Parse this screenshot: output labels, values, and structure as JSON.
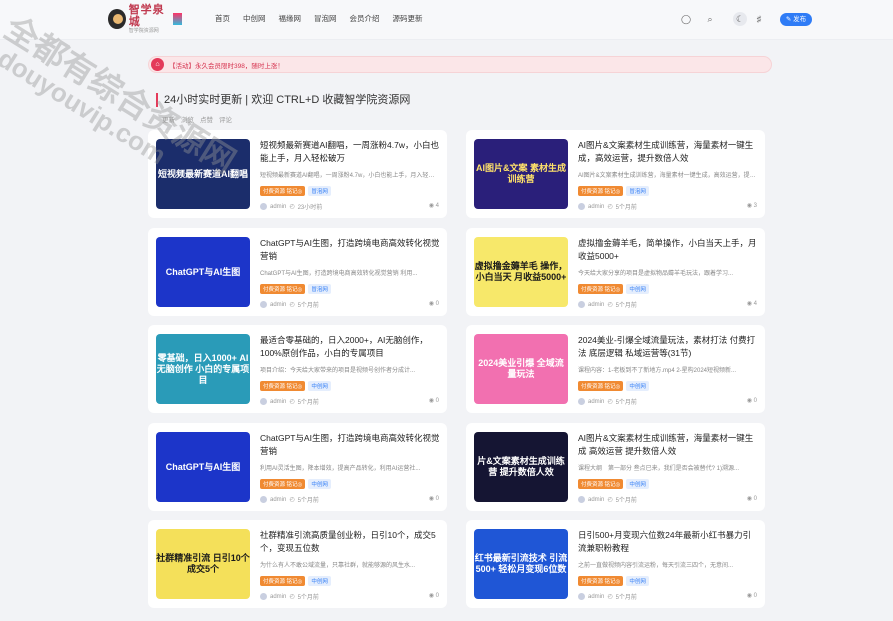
{
  "header": {
    "logo_text": "智学泉城",
    "logo_sub": "智学院资源网",
    "nav": [
      "首页",
      "中创网",
      "福缘网",
      "冒泡网",
      "会员介绍",
      "源码更新"
    ],
    "publish_label": "发布"
  },
  "notice": {
    "text": "【活动】永久会员限时398，随时上涨！"
  },
  "section": {
    "title": "24小时实时更新 | 欢迎 CTRL+D 收藏智学院资源网",
    "sort": [
      "更新",
      "浏览",
      "点赞",
      "评论"
    ]
  },
  "watermark": {
    "line1": "全都有综合资源网",
    "line2": "douyouvip.com"
  },
  "cards": [
    {
      "title": "短视频最新赛道AI翻唱，一周涨粉4.7w，小白也能上手，月入轻松破万",
      "desc": "短视频最新赛道AI翻唱，一周涨粉4.7w，小白也能上手，月入轻松破万",
      "thumb": "短视频最新赛道AI翻唱",
      "tag1": "付费资源 铭记◎",
      "tag2": "冒泡网",
      "author": "admin",
      "time": "23小时前",
      "views": "4",
      "bg": "#1b2d6b",
      "fg": "#ffffff"
    },
    {
      "title": "AI图片&文案素材生成训练营，海量素材一键生成，高效运营，提升数倍人效",
      "desc": "AI图片&文案素材生成训练营，海量素材一键生成，高效运营，提升数倍人效",
      "thumb": "AI图片&文案 素材生成训练营",
      "tag1": "付费资源 铭记◎",
      "tag2": "冒泡网",
      "author": "admin",
      "time": "5个月前",
      "views": "3",
      "bg": "#2a1f7a",
      "fg": "#ffe26a"
    },
    {
      "title": "ChatGPT与AI生图，打造跨境电商高效转化视觉营销",
      "desc": "ChatGPT与AI生图，打造跨境电商高效转化视觉营销 利用...",
      "thumb": "ChatGPT与AI生图",
      "tag1": "付费资源 铭记◎",
      "tag2": "冒泡网",
      "author": "admin",
      "time": "5个月前",
      "views": "0",
      "bg": "#1c35c9",
      "fg": "#ffffff"
    },
    {
      "title": "虚拟撸金薅羊毛，简单操作，小白当天上手，月收益5000+",
      "desc": "今天给大家分享的项目是虚拟物品薅羊毛玩法，跟着学习...",
      "thumb": "虚拟撸金薅羊毛 操作，小白当天 月收益5000+",
      "tag1": "付费资源 铭记◎",
      "tag2": "中创网",
      "author": "admin",
      "time": "5个月前",
      "views": "4",
      "bg": "#f7e86a",
      "fg": "#1a1a1a"
    },
    {
      "title": "最适合零基础的，日入2000+，AI无脑创作，100%原创作品，小白的专属项目",
      "desc": "项目介绍：今天给大家带来的项目是视频号创作者分成计...",
      "thumb": "零基础，日入1000+ AI无脑创作 小白的专属项目",
      "tag1": "付费资源 铭记◎",
      "tag2": "中创网",
      "author": "admin",
      "time": "5个月前",
      "views": "0",
      "bg": "#2a9bb8",
      "fg": "#ffffff"
    },
    {
      "title": "2024美业-引爆全域流量玩法，素材打法 付费打法 底层逻辑 私域运营等(31节)",
      "desc": "课程内容：1-老板到不了新地方.mp4 2-星构2024短视频新...",
      "thumb": "2024美业引爆 全域流量玩法",
      "tag1": "付费资源 铭记◎",
      "tag2": "中创网",
      "author": "admin",
      "time": "5个月前",
      "views": "0",
      "bg": "#f270b0",
      "fg": "#ffffff"
    },
    {
      "title": "ChatGPT与AI生图，打造跨境电商高效转化视觉营销",
      "desc": "利用AI灵活生图，降本增效，提高产品转化，利用AI运营社...",
      "thumb": "ChatGPT与AI生图",
      "tag1": "付费资源 铭记◎",
      "tag2": "中创网",
      "author": "admin",
      "time": "5个月前",
      "views": "0",
      "bg": "#1c35c9",
      "fg": "#ffffff"
    },
    {
      "title": "AI图片&文案素材生成训练营，海量素材一键生成 高效运营 提升数倍人效",
      "desc": "课程大纲　第一部分 叁点已来，我们是否会被替代? 1)溯源...",
      "thumb": "片&文案素材生成训练营 提升数倍人效",
      "tag1": "付费资源 铭记◎",
      "tag2": "中创网",
      "author": "admin",
      "time": "5个月前",
      "views": "0",
      "bg": "#151533",
      "fg": "#ffffff"
    },
    {
      "title": "社群精准引流高质量创业粉，日引10个，成交5个，变现五位数",
      "desc": "为什么有人不敢公域流量，只靠社群，就能够源的风生水...",
      "thumb": "社群精准引流 日引10个 成交5个",
      "tag1": "付费资源 铭记◎",
      "tag2": "中创网",
      "author": "admin",
      "time": "5个月前",
      "views": "0",
      "bg": "#f4e05a",
      "fg": "#1a1a1a"
    },
    {
      "title": "日引500+月变现六位数24年最新小红书暴力引流兼职粉教程",
      "desc": "之前一直做视频内容引流运粉，每天引流三四个，无意间...",
      "thumb": "红书最新引流技术 引流500+ 轻松月变现6位数",
      "tag1": "付费资源 铭记◎",
      "tag2": "中创网",
      "author": "admin",
      "time": "5个月前",
      "views": "0",
      "bg": "#1f56d6",
      "fg": "#ffffff"
    }
  ]
}
